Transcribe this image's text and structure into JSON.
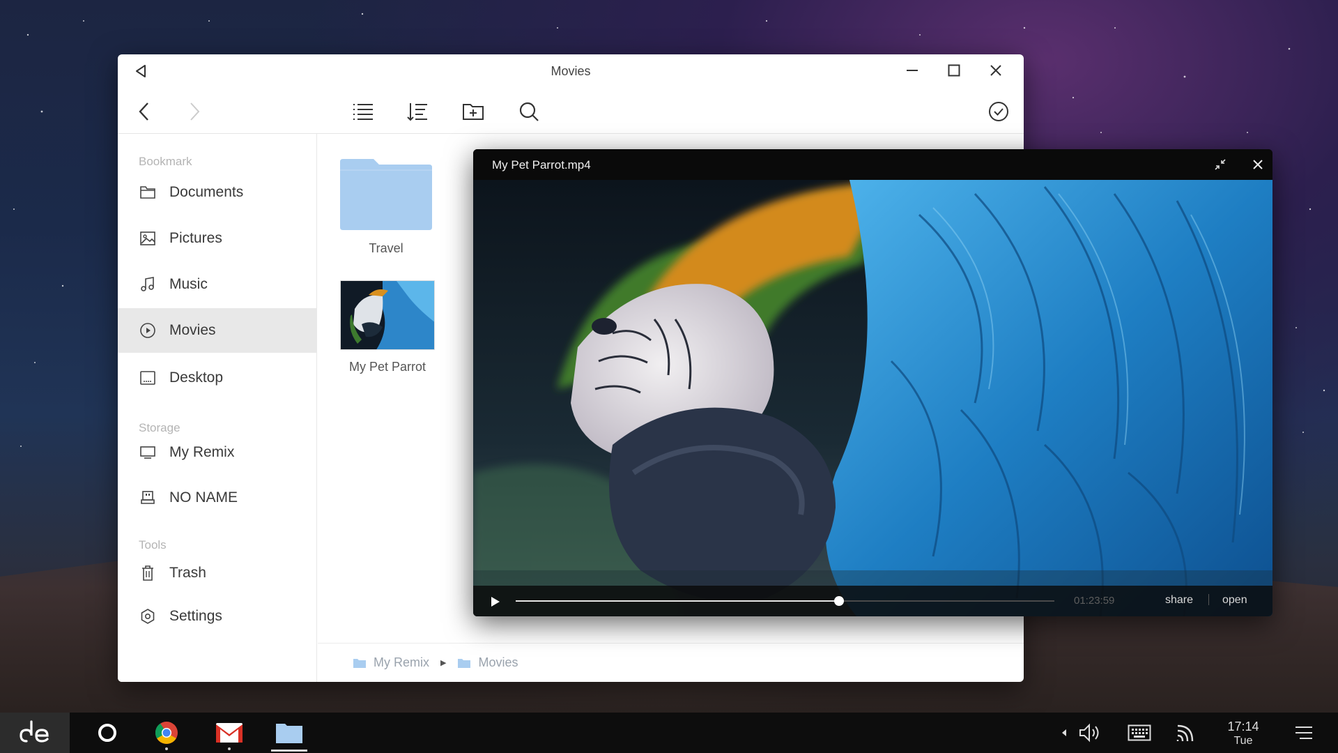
{
  "file_manager": {
    "title": "Movies",
    "sidebar": {
      "sections": [
        {
          "label": "Bookmark",
          "items": [
            {
              "label": "Documents",
              "icon": "folder-icon"
            },
            {
              "label": "Pictures",
              "icon": "image-icon"
            },
            {
              "label": "Music",
              "icon": "music-note-icon"
            },
            {
              "label": "Movies",
              "icon": "play-circle-icon",
              "active": true
            },
            {
              "label": "Desktop",
              "icon": "desktop-icon"
            }
          ]
        },
        {
          "label": "Storage",
          "items": [
            {
              "label": "My Remix",
              "icon": "monitor-icon"
            },
            {
              "label": "NO NAME",
              "icon": "usb-drive-icon"
            }
          ]
        },
        {
          "label": "Tools",
          "items": [
            {
              "label": "Trash",
              "icon": "trash-icon"
            },
            {
              "label": "Settings",
              "icon": "gear-icon"
            }
          ]
        }
      ]
    },
    "files": [
      {
        "name": "Travel",
        "type": "folder"
      },
      {
        "name": "My Pet Parrot",
        "type": "video"
      }
    ],
    "breadcrumb": [
      "My Remix",
      "Movies"
    ]
  },
  "video_player": {
    "title": "My Pet Parrot.mp4",
    "time": "01:23:59",
    "progress": 0.6,
    "share_label": "share",
    "open_label": "open"
  },
  "taskbar": {
    "time": "17:14",
    "day": "Tue"
  },
  "colors": {
    "folder": "#a9cdf0",
    "accent": "#5f9be0"
  }
}
